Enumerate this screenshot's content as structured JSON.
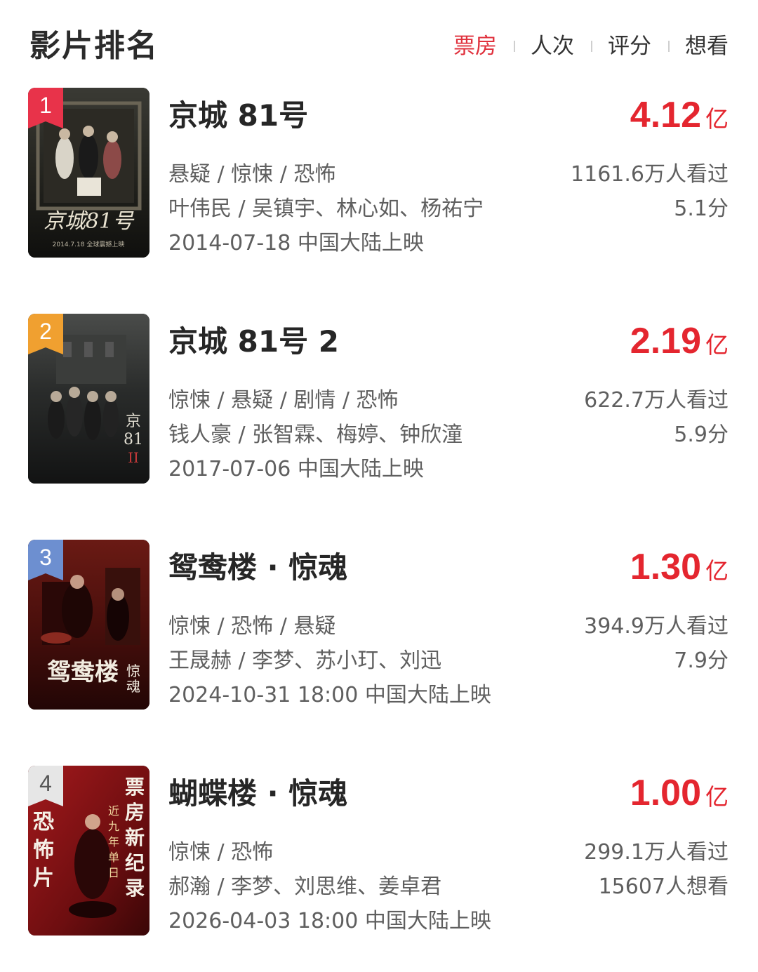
{
  "header": {
    "title": "影片排名",
    "tabs": [
      {
        "label": "票房",
        "active": true
      },
      {
        "label": "人次",
        "active": false
      },
      {
        "label": "评分",
        "active": false
      },
      {
        "label": "想看",
        "active": false
      }
    ]
  },
  "colors": {
    "accent": "#e4262f",
    "rank1_badge": "#e8334a",
    "rank2_badge": "#f0a030",
    "rank3_badge": "#6d8fd0",
    "rank4_badge": "#e6e6e6"
  },
  "movies": [
    {
      "rank": "1",
      "title": "京城 81号",
      "box_office": "4.12",
      "box_unit": "亿",
      "genres": "悬疑 / 惊悚 / 恐怖",
      "people": "叶伟民 / 吴镇宇、林心如、杨祐宁",
      "release": "2014-07-18 中国大陆上映",
      "viewers": "1161.6万人看过",
      "score": "5.1分"
    },
    {
      "rank": "2",
      "title": "京城 81号 2",
      "box_office": "2.19",
      "box_unit": "亿",
      "genres": "惊悚 / 悬疑 / 剧情 / 恐怖",
      "people": "钱人豪 / 张智霖、梅婷、钟欣潼",
      "release": "2017-07-06 中国大陆上映",
      "viewers": "622.7万人看过",
      "score": "5.9分"
    },
    {
      "rank": "3",
      "title": "鸳鸯楼 · 惊魂",
      "box_office": "1.30",
      "box_unit": "亿",
      "genres": "惊悚 / 恐怖 / 悬疑",
      "people": "王晟赫 / 李梦、苏小玎、刘迅",
      "release": "2024-10-31 18:00 中国大陆上映",
      "viewers": "394.9万人看过",
      "score": "7.9分"
    },
    {
      "rank": "4",
      "title": "蝴蝶楼 · 惊魂",
      "box_office": "1.00",
      "box_unit": "亿",
      "genres": "惊悚 / 恐怖",
      "people": "郝瀚 / 李梦、刘思维、姜卓君",
      "release": "2026-04-03 18:00 中国大陆上映",
      "viewers": "299.1万人看过",
      "score": "15607人想看"
    }
  ]
}
